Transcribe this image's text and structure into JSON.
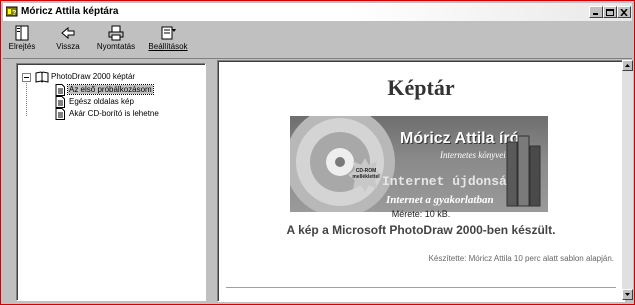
{
  "window": {
    "title": "Móricz Attila képtára",
    "controls": [
      "minimize",
      "maximize",
      "close"
    ]
  },
  "toolbar": {
    "buttons": [
      {
        "label": "Elrejtés",
        "icon": "hide-pane-icon"
      },
      {
        "label": "Vissza",
        "icon": "back-arrow-icon"
      },
      {
        "label": "Nyomtatás",
        "icon": "printer-icon"
      },
      {
        "label": "Beállítások",
        "icon": "options-icon"
      }
    ]
  },
  "tree": {
    "root": {
      "label": "PhotoDraw 2000 képtár",
      "icon": "book-icon",
      "expanded": true
    },
    "items": [
      {
        "label": "Az első próbálkozásom",
        "icon": "document-icon",
        "selected": true
      },
      {
        "label": "Egész oldalas kép",
        "icon": "document-icon",
        "selected": false
      },
      {
        "label": "Akár CD-borító is lehetne",
        "icon": "document-icon",
        "selected": false
      }
    ]
  },
  "content": {
    "heading": "Képtár",
    "banner": {
      "name": "Móricz Attila író",
      "subtitle": "Internetes könyvei",
      "badge": "CD-ROM melléklettel",
      "news": "Internet újdonságai",
      "slogan": "Internet a gyakorlatban"
    },
    "size": "Mérete: 10 kB.",
    "caption": "A kép a Microsoft PhotoDraw 2000-ben készült.",
    "credit": "Készítette: Móricz Attila 10 perc alatt sablon alapján."
  },
  "colors": {
    "window_border": "#d40000",
    "face": "#c0c0c0"
  }
}
